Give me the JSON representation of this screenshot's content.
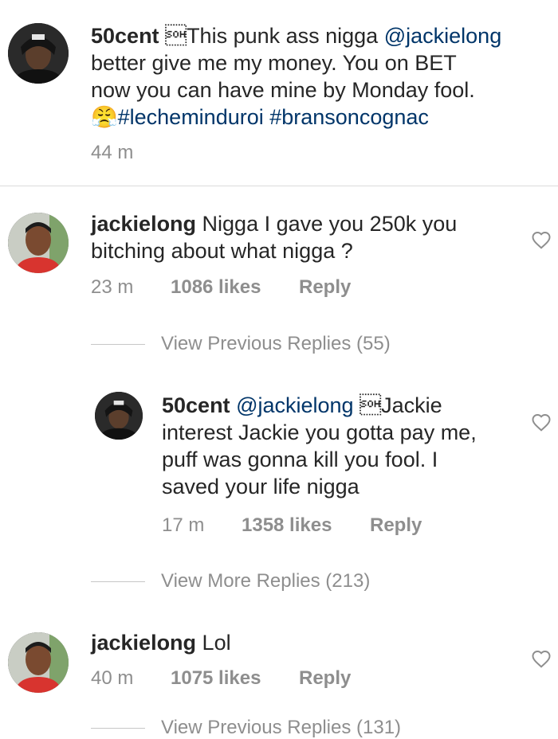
{
  "comments": [
    {
      "username": "50cent",
      "line1_rest": " \u0001This punk ass nigga ",
      "line1_link": "@jackielong",
      "line2": "better give me my money. You on BET",
      "line3": "now you can have mine by Monday fool.",
      "line4_emoji": "😤",
      "line4_tags": "#lecheminduroi #bransoncognac",
      "time": "44 m"
    },
    {
      "username": "jackielong",
      "line1_rest": " Nigga I gave you 250k you",
      "line2": "bitching about what nigga ?",
      "time": "23 m",
      "likes": "1086 likes",
      "reply_label": "Reply"
    },
    {
      "username": "50cent",
      "line1_link": "@jackielong",
      "line1_rest": " \u0001Jackie",
      "line2": "interest Jackie you gotta pay me,",
      "line3": "puff was gonna kill you fool. I",
      "line4": "saved your life nigga",
      "time": "17 m",
      "likes": "1358 likes",
      "reply_label": "Reply"
    },
    {
      "username": "jackielong",
      "line1_rest": " Lol",
      "time": "40 m",
      "likes": "1075 likes",
      "reply_label": "Reply"
    }
  ],
  "view_previous": "View Previous Replies (55)",
  "view_more": "View More Replies (213)",
  "view_previous_bottom": "View Previous Replies (131)",
  "colors": {
    "text": "#262626",
    "link": "#003569",
    "muted": "#8e8e8e",
    "divider": "#dbdbdb"
  }
}
